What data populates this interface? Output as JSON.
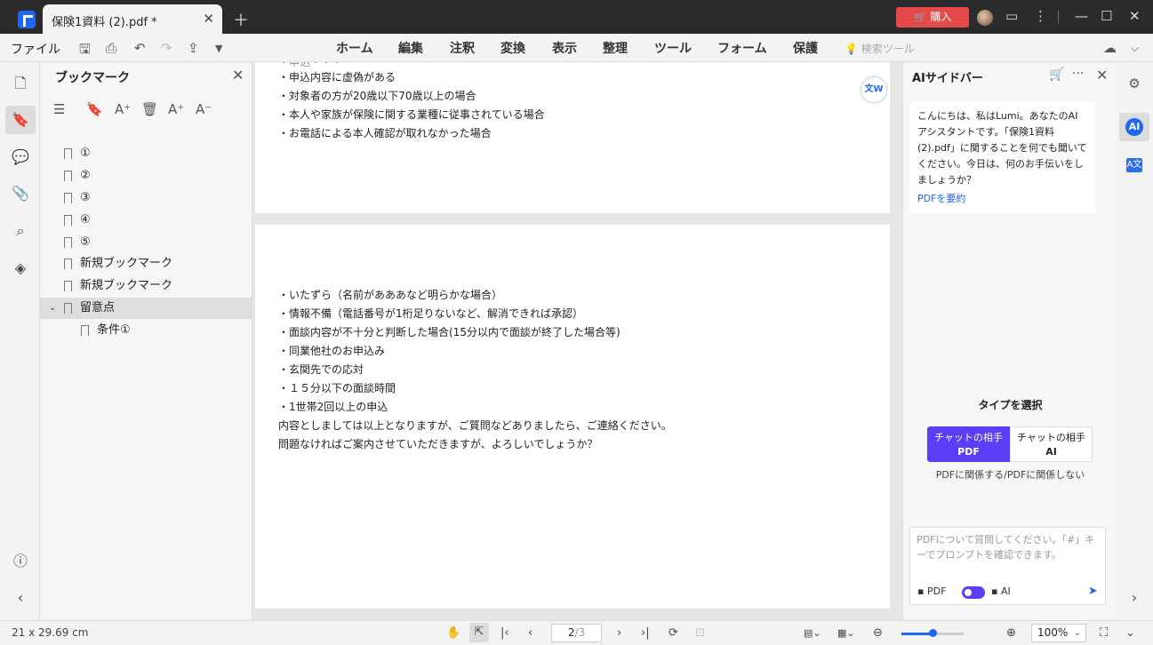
{
  "titlebar": {
    "tab_title": "保険1資料 (2).pdf *",
    "buy_label": "購入",
    "icons": [
      "app-logo-icon",
      "close-tab-icon",
      "new-tab-icon",
      "cart-icon",
      "avatar",
      "chat-icon",
      "more-vert-icon",
      "minimize-icon",
      "maximize-icon",
      "close-window-icon"
    ]
  },
  "menubar": {
    "file_label": "ファイル",
    "tabs": [
      "ホーム",
      "編集",
      "注釈",
      "変換",
      "表示",
      "整理",
      "ツール",
      "フォーム",
      "保護"
    ],
    "search_tools_label": "検索ツール"
  },
  "bookmarks": {
    "title": "ブックマーク",
    "items": [
      {
        "label": "①"
      },
      {
        "label": "②"
      },
      {
        "label": "③"
      },
      {
        "label": "④"
      },
      {
        "label": "⑤"
      },
      {
        "label": "新規ブックマーク"
      },
      {
        "label": "新規ブックマーク"
      },
      {
        "label": "留意点"
      },
      {
        "label": "条件①"
      }
    ]
  },
  "document": {
    "page1_lines": [
      "・申込内容に虚偽がある",
      "・対象者の方が20歳以下70歳以上の場合",
      "・本人や家族が保険に関する業種に従事されている場合",
      "・お電話による本人確認が取れなかった場合"
    ],
    "page2_lines": [
      "・いたずら（名前があああなど明らかな場合）",
      "・情報不備（電話番号が1桁足りないなど、解消できれば承認）",
      "・面談内容が不十分と判断した場合(15分以内で面談が終了した場合等)",
      "・同業他社のお申込み",
      "・玄関先での応対",
      "・１５分以下の面談時間",
      "・1世帯2回以上の申込",
      "内容としましては以上となりますが、ご質問などありましたら、ご連絡ください。",
      "問題なければご案内させていただきますが、よろしいでしょうか？"
    ]
  },
  "ai_sidebar": {
    "title": "AIサイドバー",
    "greeting": "こんにちは、私はLumi。あなたのAIアシスタントです。「保険1資料(2).pdf」に関することを何でも聞いてください。今日は、何のお手伝いをしましょうか？",
    "summarize_link": "PDFを要約",
    "type_title": "タイプを選択",
    "option_pdf_top": "チャットの相手",
    "option_pdf_bottom": "PDF",
    "option_ai_top": "チャットの相手",
    "option_ai_bottom": "AI",
    "note": "PDFに関係する/PDFに関係しない",
    "input_placeholder": "PDFについて質問してください。「#」キーでプロンプトを確認できます。",
    "toggle_left": "PDF",
    "toggle_right": "AI",
    "toggle_value": "AI"
  },
  "statusbar": {
    "page_size": "21 x 29.69 cm",
    "current_page": "2",
    "total_pages": "/3",
    "zoom": "100%",
    "zoom_fraction": 0.5
  }
}
